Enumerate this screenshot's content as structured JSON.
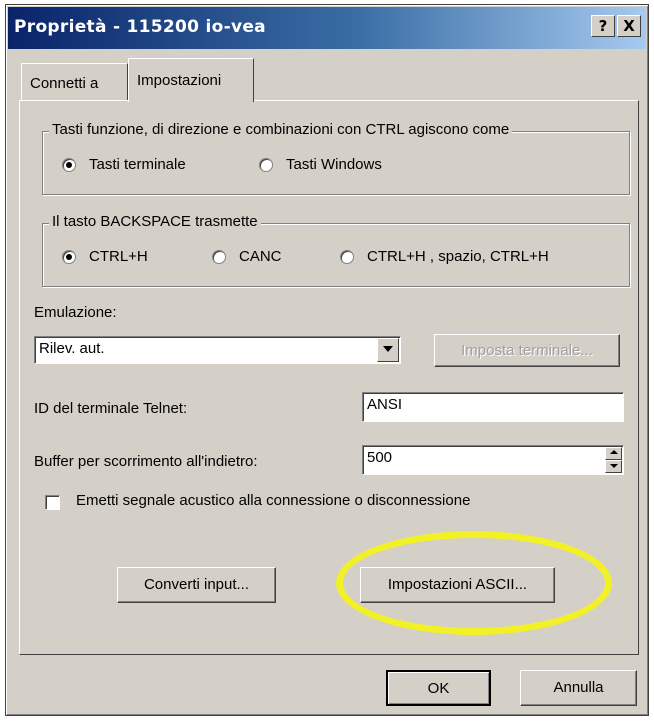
{
  "window": {
    "title": "Proprietà - 115200 io-vea",
    "help_glyph": "?",
    "close_glyph": "X"
  },
  "tabs": [
    {
      "label": "Connetti a",
      "active": false
    },
    {
      "label": "Impostazioni",
      "active": true
    }
  ],
  "keys_group": {
    "legend": "Tasti funzione, di direzione e combinazioni con CTRL agiscono come",
    "options": [
      {
        "label": "Tasti terminale",
        "checked": true
      },
      {
        "label": "Tasti Windows",
        "checked": false
      }
    ]
  },
  "backspace_group": {
    "legend": "Il tasto BACKSPACE trasmette",
    "options": [
      {
        "label": "CTRL+H",
        "checked": true
      },
      {
        "label": "CANC",
        "checked": false
      },
      {
        "label": "CTRL+H , spazio, CTRL+H",
        "checked": false
      }
    ]
  },
  "emulation": {
    "label": "Emulazione:",
    "selected": "Rilev. aut.",
    "terminal_button": "Imposta terminale..."
  },
  "telnet_id": {
    "label": "ID del terminale Telnet:",
    "value": "ANSI"
  },
  "buffer": {
    "label": "Buffer per scorrimento all'indietro:",
    "value": "500"
  },
  "beep": {
    "label": "Emetti segnale acustico alla connessione o disconnessione",
    "checked": false
  },
  "buttons": {
    "convert_input": "Converti input...",
    "ascii_settings": "Impostazioni ASCII...",
    "ok": "OK",
    "cancel": "Annulla"
  },
  "colors": {
    "highlight_ellipse": "#f2f026",
    "title_bar": "#0a246a",
    "dialog_face": "#d4d0c8"
  }
}
